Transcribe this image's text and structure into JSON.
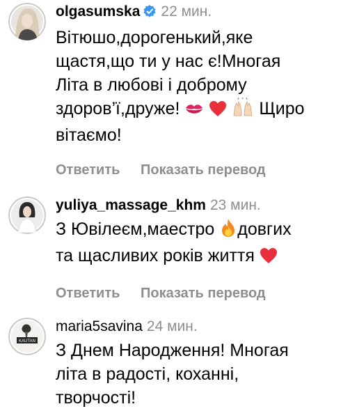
{
  "comments": [
    {
      "username": "olgasumska",
      "verified": true,
      "time": "22 мин.",
      "lines": [
        "Вітюшо,дорогенький,яке",
        "щастя,що ти у нас є!Многая",
        "Літа в любові і доброму",
        "здоров’ї,друже!",
        "Щиро",
        "вітаємо!"
      ],
      "emoji_icons": [
        "kiss-mark-icon",
        "red-heart-icon",
        "raising-hands-icon"
      ],
      "reply_label": "Ответить",
      "translate_label": "Показать перевод"
    },
    {
      "username": "yuliya_massage_khm",
      "verified": false,
      "time": "23 мин.",
      "lines": [
        "З Ювілеєм,маестро",
        "довгих",
        "та щасливих років життя"
      ],
      "emoji_icons": [
        "fire-icon",
        "red-heart-icon"
      ],
      "reply_label": "Ответить",
      "translate_label": "Показать перевод"
    },
    {
      "username": "maria5savina",
      "verified": false,
      "time": "24 мин.",
      "lines": [
        "З Днем Народження! Многая",
        "літа в радості, коханні,",
        "творчості!"
      ],
      "avatar_text": "KAUTAN",
      "emoji_icons": []
    }
  ],
  "colors": {
    "text": "#000000",
    "secondary": "#8e8e8e",
    "verified_blue": "#3897f0",
    "story_ring_gray": "#c7c7c7"
  }
}
